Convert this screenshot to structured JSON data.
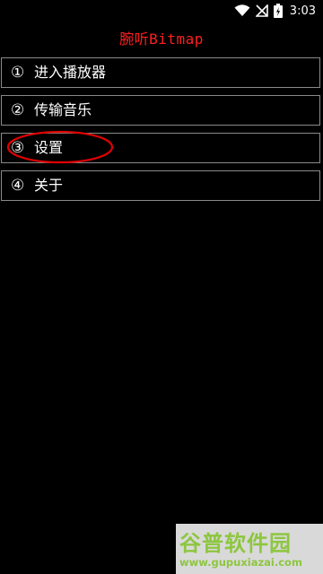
{
  "status_bar": {
    "time": "3:03",
    "icons": [
      "wifi-icon",
      "no-signal-icon",
      "battery-charging-icon"
    ]
  },
  "app": {
    "title": "腕听Bitmap"
  },
  "menu": {
    "items": [
      {
        "num": "①",
        "label": "进入播放器"
      },
      {
        "num": "②",
        "label": "传输音乐"
      },
      {
        "num": "③",
        "label": "设置"
      },
      {
        "num": "④",
        "label": "关于"
      }
    ]
  },
  "annotation": {
    "color": "#e00000",
    "target": "设置"
  },
  "watermark": {
    "logo_text": "谷普软件园",
    "url": "www.gupuxiazai.com",
    "color": "#8dc63f"
  },
  "colors": {
    "background": "#000000",
    "title": "#ff1f1f",
    "border": "#8a8a8a",
    "text": "#ffffff"
  }
}
